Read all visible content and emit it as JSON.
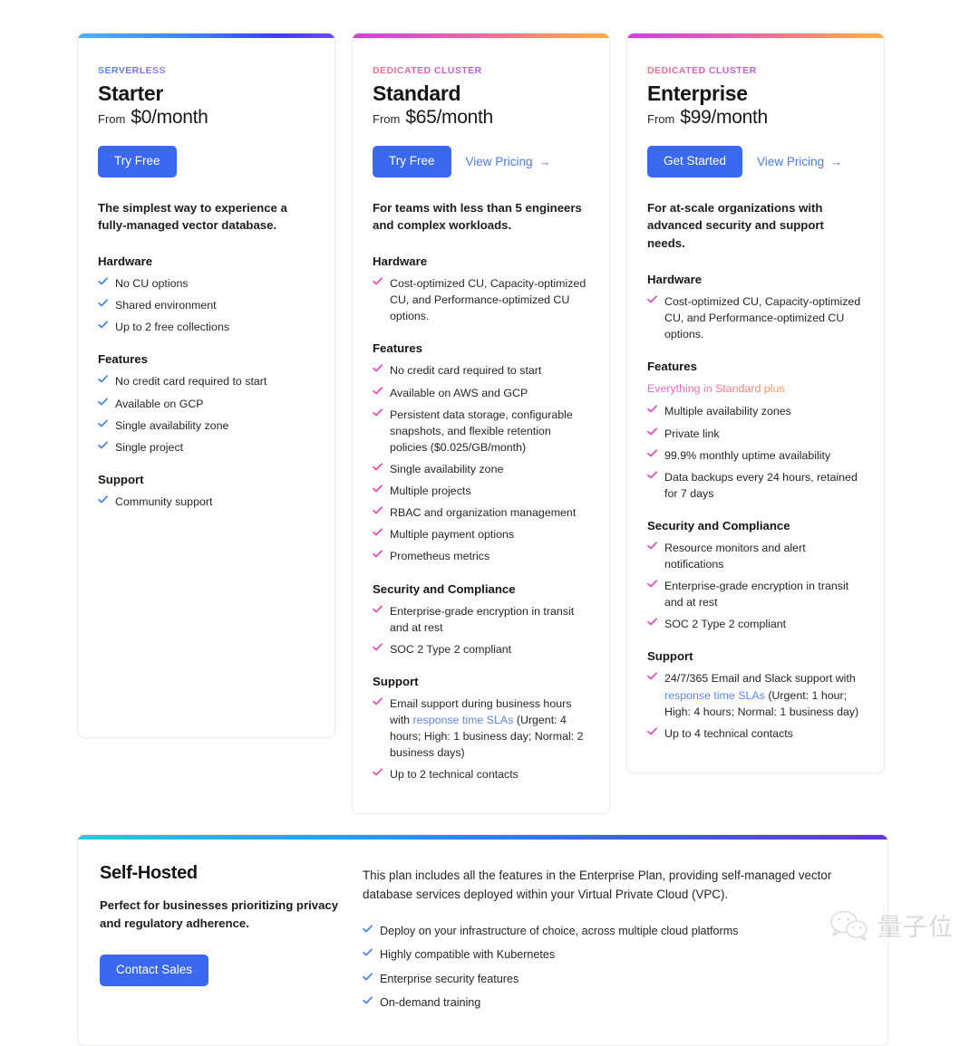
{
  "plans": [
    {
      "eyebrow": "SERVERLESS",
      "name": "Starter",
      "price_from": "From",
      "price": "$0/month",
      "primary_cta": "Try Free",
      "secondary_cta": null,
      "secondary_arrow": "→",
      "description": "The simplest way to experience a fully-managed vector database.",
      "check_color": "#3b7bf0",
      "sections": [
        {
          "title": "Hardware",
          "items": [
            {
              "text": "No CU options"
            },
            {
              "text": "Shared environment"
            },
            {
              "text": "Up to 2 free collections"
            }
          ]
        },
        {
          "title": "Features",
          "items": [
            {
              "text": "No credit card required to start"
            },
            {
              "text": "Available on GCP"
            },
            {
              "text": "Single availability zone"
            },
            {
              "text": "Single project"
            }
          ]
        },
        {
          "title": "Support",
          "items": [
            {
              "text": "Community support"
            }
          ]
        }
      ]
    },
    {
      "eyebrow": "DEDICATED CLUSTER",
      "name": "Standard",
      "price_from": "From",
      "price": "$65/month",
      "primary_cta": "Try Free",
      "secondary_cta": "View Pricing",
      "secondary_arrow": "→",
      "description": "For teams with less than 5 engineers and complex workloads.",
      "check_color": "#ec3fb5",
      "sections": [
        {
          "title": "Hardware",
          "items": [
            {
              "text": "Cost-optimized CU, Capacity-optimized CU, and Performance-optimized CU options."
            }
          ]
        },
        {
          "title": "Features",
          "items": [
            {
              "text": "No credit card required to start"
            },
            {
              "text": "Available on AWS and GCP"
            },
            {
              "text": "Persistent data storage, configurable snapshots, and flexible retention policies ($0.025/GB/month)"
            },
            {
              "text": "Single availability zone"
            },
            {
              "text": "Multiple projects"
            },
            {
              "text": "RBAC and organization management"
            },
            {
              "text": "Multiple payment options"
            },
            {
              "text": "Prometheus metrics"
            }
          ]
        },
        {
          "title": "Security and Compliance",
          "items": [
            {
              "text": "Enterprise-grade encryption in transit and at rest"
            },
            {
              "text": "SOC 2 Type 2 compliant"
            }
          ]
        },
        {
          "title": "Support",
          "items": [
            {
              "pre": "Email support during business hours with ",
              "link": "response time SLAs",
              "post": " (Urgent: 4 hours; High: 1 business day; Normal: 2 business days)"
            },
            {
              "text": "Up to 2 technical contacts"
            }
          ]
        }
      ]
    },
    {
      "eyebrow": "DEDICATED CLUSTER",
      "name": "Enterprise",
      "price_from": "From",
      "price": "$99/month",
      "primary_cta": "Get Started",
      "secondary_cta": "View Pricing",
      "secondary_arrow": "→",
      "description": "For at-scale organizations with advanced security and support needs.",
      "check_color": "#ec3fb5",
      "sections": [
        {
          "title": "Hardware",
          "items": [
            {
              "text": "Cost-optimized CU, Capacity-optimized CU, and Performance-optimized CU options."
            }
          ]
        },
        {
          "title": "Features",
          "highlight": "Everything in Standard plus",
          "items": [
            {
              "text": "Multiple availability zones"
            },
            {
              "text": "Private link"
            },
            {
              "text": "99.9% monthly uptime availability"
            },
            {
              "text": "Data backups every 24 hours, retained for 7 days"
            }
          ]
        },
        {
          "title": "Security and Compliance",
          "items": [
            {
              "text": "Resource monitors and alert notifications"
            },
            {
              "text": "Enterprise-grade encryption in transit and at rest"
            },
            {
              "text": "SOC 2 Type 2 compliant"
            }
          ]
        },
        {
          "title": "Support",
          "items": [
            {
              "pre": "24/7/365 Email and Slack support with ",
              "link": "response time SLAs",
              "post": " (Urgent: 1 hour; High: 4 hours; Normal: 1 business day)"
            },
            {
              "text": "Up to 4 technical contacts"
            }
          ]
        }
      ]
    }
  ],
  "self_hosted": {
    "title": "Self-Hosted",
    "subtitle": "Perfect for businesses prioritizing privacy and regulatory adherence.",
    "cta": "Contact Sales",
    "paragraph": "This plan includes all the features in the Enterprise Plan, providing self-managed vector database services deployed within your Virtual Private Cloud (VPC).",
    "check_color": "#3b7bf0",
    "features": [
      "Deploy on your infrastructure of choice, across multiple cloud platforms",
      "Highly compatible with Kubernetes",
      "Enterprise security features",
      "On-demand training"
    ]
  },
  "watermark": {
    "text": "量子位"
  },
  "colors": {
    "primary_button": "#3b68f0",
    "link": "#4a7bf5",
    "check_blue": "#3b7bf0",
    "check_pink": "#ec3fb5"
  }
}
